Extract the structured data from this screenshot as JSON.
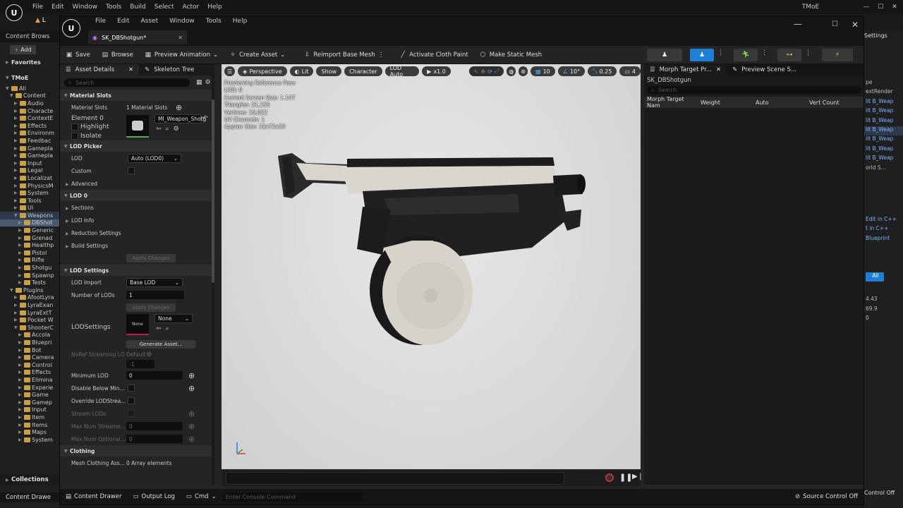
{
  "bg": {
    "menu": [
      "File",
      "Edit",
      "Window",
      "Tools",
      "Build",
      "Select",
      "Actor",
      "Help"
    ],
    "project_title": "TMoE",
    "tab_label": "L",
    "content_browser": "Content Brows",
    "add_label": "Add",
    "favorites": "Favorites",
    "project": "TMoE",
    "tree": [
      "All",
      "Content",
      "Audio",
      "Characte",
      "ContextE",
      "Effects",
      "Environm",
      "Feedbac",
      "Gamepla",
      "Gamepla",
      "Input",
      "Legal",
      "Localizat",
      "PhysicsM",
      "System",
      "Tools",
      "UI",
      "Weapons",
      "DBShot",
      "Generic",
      "Grenad",
      "Healthp",
      "Pistol",
      "Rifle",
      "Shotgu",
      "Spawnp",
      "Tests",
      "Plugins",
      "AfootLyra",
      "LyraExan",
      "LyraExtT",
      "Pocket W",
      "ShooterC",
      "Accola",
      "Bluepri",
      "Bot",
      "Camera",
      "Control",
      "Effects",
      "Elimina",
      "Experie",
      "Game",
      "Gamep",
      "Input",
      "Item",
      "Items",
      "Maps",
      "System"
    ],
    "collections": "Collections",
    "content_drawer": "Content Drawe",
    "settings": "Settings",
    "right_texts": [
      "pe",
      "extRender",
      "lit B_Weap",
      "lit B_Weap",
      "lit B_Weap",
      "lit B_Weap",
      "lit B_Weap",
      "lit B_Weap",
      "lit B_Weap",
      "orld S...",
      "Edit in C++",
      "t in C++",
      "Blueprint",
      "All",
      "4.43",
      "69.9",
      "0"
    ],
    "source_control": "Control Off"
  },
  "win": {
    "menu": [
      "File",
      "Edit",
      "Asset",
      "Window",
      "Tools",
      "Help"
    ],
    "tab_title": "SK_DBShotgun*",
    "toolbar": [
      "Save",
      "Browse",
      "Preview Animation",
      "Create Asset",
      "Reimport Base Mesh",
      "Activate Cloth Paint",
      "Make Static Mesh"
    ]
  },
  "details": {
    "tab1": "Asset Details",
    "tab2": "Skeleton Tree",
    "search": "Search",
    "material_slots_header": "Material Slots",
    "material_slots_label": "Material Slots",
    "material_slots_value": "1 Material Slots",
    "element0": "Element 0",
    "highlight": "Highlight",
    "isolate": "Isolate",
    "material_name": "MI_Weapon_Shotg",
    "lod_picker_header": "LOD Picker",
    "lod": "LOD",
    "lod_value": "Auto (LOD0)",
    "custom": "Custom",
    "advanced": "Advanced",
    "lod0_header": "LOD 0",
    "sections": "Sections",
    "lod_info": "LOD Info",
    "reduction": "Reduction Settings",
    "build": "Build Settings",
    "apply_changes": "Apply Changes",
    "lod_settings_header": "LOD Settings",
    "lod_import": "LOD Import",
    "lod_import_value": "Base LOD",
    "num_lods": "Number of LODs",
    "num_lods_value": "1",
    "lodsettings": "LODSettings",
    "none": "None",
    "generate": "Generate Asset...",
    "noref": "NoRef Streaming LO",
    "default": "Default",
    "minus1": "-1",
    "min_lod": "Minimum LOD",
    "min_lod_value": "0",
    "disable_below": "Disable Below Min...",
    "override": "Override LODStrea...",
    "stream_lods": "Stream LODs",
    "max_stream": "Max Num Streame...",
    "max_optional": "Max Num Optional...",
    "zero": "0",
    "clothing_header": "Clothing",
    "mesh_clothing": "Mesh Clothing Ass...",
    "mesh_clothing_value": "0 Array elements"
  },
  "viewport": {
    "perspective": "Perspective",
    "lit": "Lit",
    "show": "Show",
    "character": "Character",
    "lod_auto": "LOD Auto",
    "speed": "x1.0",
    "grid": "10",
    "angle": "10°",
    "scale": "0.25",
    "cam": "4",
    "stats": [
      "Previewing Reference Pose",
      "LOD: 0",
      "Current Screen Size: 1.147",
      "Triangles: 21,155",
      "Vertices: 16,022",
      "UV Channels: 1",
      "Approx Size: 32x72x33"
    ]
  },
  "right": {
    "tab1": "Morph Target Pr...",
    "tab2": "Preview Scene S...",
    "asset": "SK_DBShotgun",
    "search": "Search",
    "cols": [
      "Morph Target Nam",
      "Weight",
      "Auto",
      "Vert Count"
    ]
  },
  "status": {
    "content_drawer": "Content Drawer",
    "output_log": "Output Log",
    "cmd": "Cmd",
    "console_placeholder": "Enter Console Command",
    "source_control": "Source Control Off"
  }
}
